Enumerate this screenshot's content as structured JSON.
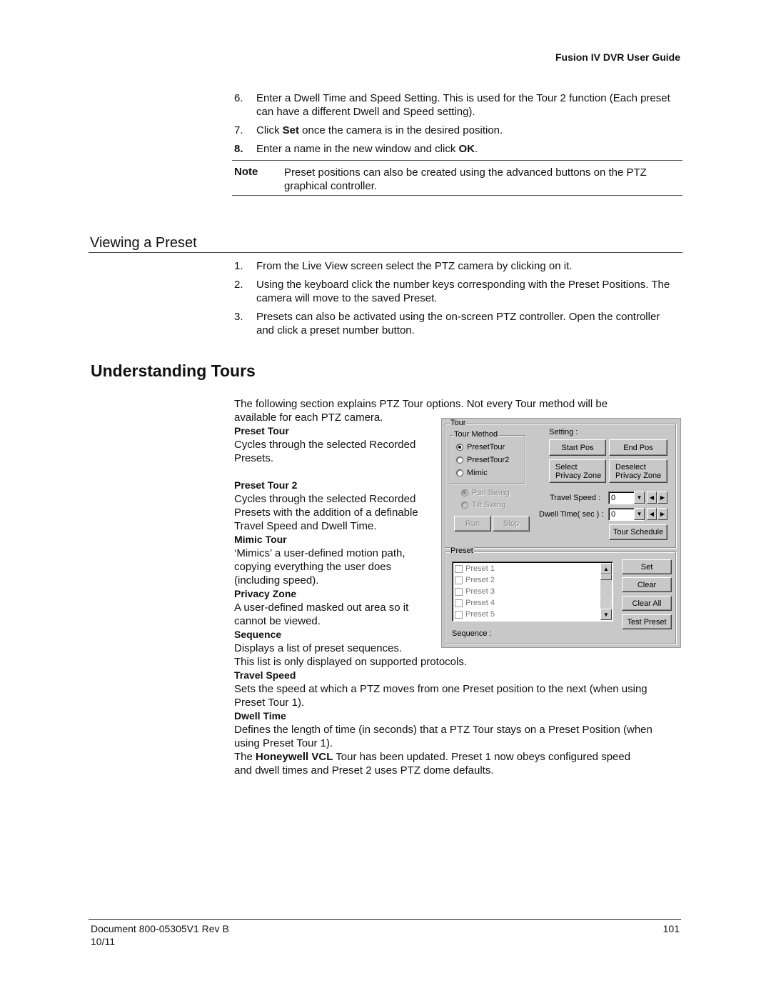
{
  "header": {
    "title": "Fusion IV DVR User Guide"
  },
  "steps_top": [
    {
      "num": "6.",
      "text": "Enter a Dwell Time and Speed Setting. This is used for the Tour 2 function (Each preset can have a different Dwell and Speed setting)."
    },
    {
      "num": "7.",
      "text_before": "Click ",
      "bold": "Set",
      "text_after": " once the camera is in the desired position."
    },
    {
      "num": "8.",
      "text_before": "Enter a name in the new window and click ",
      "bold": "OK",
      "text_after": "."
    }
  ],
  "note": {
    "label": "Note",
    "text": "Preset positions can also be created using the advanced buttons on the PTZ graphical controller."
  },
  "viewing_preset": {
    "heading": "Viewing a Preset",
    "steps": [
      {
        "num": "1.",
        "text": "From the Live View screen select the PTZ camera by clicking on it."
      },
      {
        "num": "2.",
        "text": "Using the keyboard click the number keys corresponding with the Preset Positions. The camera will move to the saved Preset."
      },
      {
        "num": "3.",
        "text": "Presets can also be activated using the on-screen PTZ controller.  Open the controller and click a preset number button."
      }
    ]
  },
  "understanding_tours": {
    "heading": "Understanding Tours",
    "intro_line1": "The following section explains PTZ Tour options. Not every Tour method will be",
    "intro_line2": "available for each PTZ camera.",
    "terms": [
      {
        "term": "Preset Tour",
        "lines": [
          "Cycles through the selected Recorded",
          "Presets."
        ]
      },
      {
        "term": "Preset Tour 2",
        "lines": [
          "Cycles through the selected Recorded",
          "Presets with the addition of a definable",
          "Travel Speed and Dwell Time."
        ]
      },
      {
        "term": "Mimic Tour",
        "lines": [
          "‘Mimics’ a user-defined motion path,",
          "copying everything the user does",
          "(including speed)."
        ]
      },
      {
        "term": "Privacy Zone",
        "lines": [
          "A user-defined masked out area so it",
          "cannot be viewed."
        ]
      },
      {
        "term": "Sequence",
        "lines": [
          "Displays a list of preset sequences.",
          "This list is only displayed on supported protocols."
        ]
      },
      {
        "term": "Travel Speed",
        "lines": [
          "Sets the speed at which a PTZ moves from one Preset position to the next (when using",
          "Preset Tour 1)."
        ]
      },
      {
        "term": "Dwell Time",
        "lines": [
          "Defines the length of time (in seconds) that a PTZ Tour stays on a Preset Position (when",
          "using Preset Tour 1)."
        ]
      }
    ],
    "closing_before": "The ",
    "closing_bold": "Honeywell VCL",
    "closing_after": " Tour has been updated.  Preset 1 now obeys configured speed",
    "closing_line2": "and dwell times and Preset 2 uses PTZ dome defaults."
  },
  "dialog": {
    "tour_group": "Tour",
    "tour_method_group": "Tour Method",
    "methods": [
      {
        "label": "PresetTour",
        "selected": true
      },
      {
        "label": "PresetTour2",
        "selected": false
      },
      {
        "label": "Mimic",
        "selected": false
      }
    ],
    "swing": [
      {
        "label": "Pan Swing",
        "selected": true,
        "disabled": true
      },
      {
        "label": "Tilt Swing",
        "selected": false,
        "disabled": true
      }
    ],
    "run_label": "Run",
    "stop_label": "Stop",
    "setting_label": "Setting  :",
    "start_pos": "Start Pos",
    "end_pos": "End Pos",
    "select_pz_1": "Select",
    "select_pz_2": "Privacy Zone",
    "deselect_pz_1": "Deselect",
    "deselect_pz_2": "Privacy Zone",
    "travel_speed_label": "Travel Speed  :",
    "travel_speed_value": "0",
    "dwell_time_label": "Dwell Time( sec )  :",
    "dwell_time_value": "0",
    "tour_schedule": "Tour Schedule",
    "preset_group": "Preset",
    "presets": [
      "Preset 1",
      "Preset 2",
      "Preset 3",
      "Preset 4",
      "Preset 5"
    ],
    "set_label": "Set",
    "clear_label": "Clear",
    "clear_all_label": "Clear All",
    "test_preset_label": "Test Preset",
    "sequence_label": "Sequence :"
  },
  "footer": {
    "document": "Document 800-05305V1 Rev B",
    "date": "10/11",
    "page": "101"
  }
}
